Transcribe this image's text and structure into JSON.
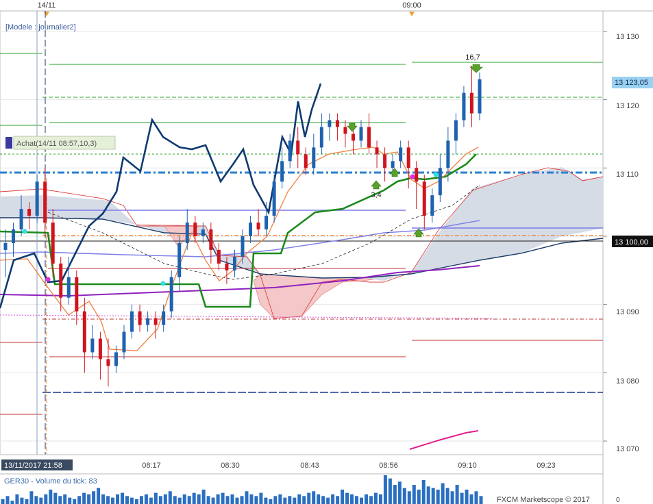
{
  "top_axis": {
    "labels": [
      "14/11",
      "09:00"
    ]
  },
  "header": {
    "model_label": "[Modele : journalier2]",
    "order_label": "Achat(14/11 08:57,10,3)"
  },
  "signals": {
    "arrow_values": [
      "16,7",
      "3,4"
    ]
  },
  "price_axis": {
    "ticks": [
      "13 130",
      "13 120",
      "13 110",
      "13 100",
      "13 090",
      "13 080",
      "13 070"
    ],
    "last_price": "13 123,05",
    "level_label": "13 100,00"
  },
  "time_axis": {
    "cursor_label": "13/11/2017 21:58",
    "ticks": [
      "08:17",
      "08:30",
      "08:43",
      "08:56",
      "09:10",
      "09:23"
    ]
  },
  "volume_panel": {
    "label": "GER30 - Volume du tick: 83",
    "brand": "FXCM Marketscope © 2017",
    "axis_zero": "0",
    "values": [
      3,
      5,
      2,
      6,
      4,
      3,
      8,
      5,
      4,
      6,
      9,
      7,
      5,
      6,
      4,
      3,
      5,
      7,
      6,
      8,
      10,
      6,
      5,
      4,
      6,
      7,
      5,
      4,
      3,
      5,
      6,
      4,
      7,
      5,
      6,
      8,
      5,
      4,
      6,
      5,
      7,
      6,
      9,
      5,
      4,
      6,
      7,
      5,
      6,
      4,
      5,
      8,
      6,
      5,
      7,
      4,
      3,
      5,
      6,
      4,
      5,
      4,
      6,
      5,
      7,
      8,
      6,
      5,
      4,
      6,
      5,
      9,
      7,
      6,
      5,
      4,
      6,
      5,
      7,
      6,
      18,
      16,
      12,
      14,
      10,
      8,
      12,
      9,
      15,
      11,
      10,
      9,
      13,
      10,
      8,
      12,
      7,
      9,
      6,
      8,
      5
    ]
  },
  "chart_data": {
    "type": "candlestick",
    "symbol": "GER30",
    "y_range": [
      13068,
      13133
    ],
    "x_ticks": [
      "08:17",
      "08:30",
      "08:43",
      "08:56",
      "09:10",
      "09:23"
    ],
    "last_price": 13123.05,
    "candles": [
      [
        13098,
        13099,
        13094,
        13101
      ],
      [
        13099,
        13101,
        13097,
        13102
      ],
      [
        13101,
        13104,
        13100,
        13106
      ],
      [
        13104,
        13103,
        13101,
        13105
      ],
      [
        13103,
        13108,
        13102,
        13109
      ],
      [
        13108,
        13102,
        13100,
        13110
      ],
      [
        13102,
        13096,
        13094,
        13104
      ],
      [
        13096,
        13091,
        13089,
        13097
      ],
      [
        13091,
        13094,
        13090,
        13097
      ],
      [
        13094,
        13089,
        13087,
        13095
      ],
      [
        13089,
        13083,
        13080,
        13091
      ],
      [
        13083,
        13085,
        13082,
        13087
      ],
      [
        13085,
        13082,
        13079,
        13086
      ],
      [
        13082,
        13081,
        13078,
        13085
      ],
      [
        13081,
        13083,
        13080,
        13084
      ],
      [
        13083,
        13086,
        13082,
        13087
      ],
      [
        13086,
        13089,
        13085,
        13090
      ],
      [
        13089,
        13087,
        13086,
        13090
      ],
      [
        13087,
        13088,
        13086,
        13089
      ],
      [
        13088,
        13087,
        13085,
        13089
      ],
      [
        13087,
        13089,
        13086,
        13090
      ],
      [
        13089,
        13094,
        13088,
        13095
      ],
      [
        13094,
        13099,
        13092,
        13100
      ],
      [
        13099,
        13102,
        13098,
        13104
      ],
      [
        13102,
        13100,
        13099,
        13103
      ],
      [
        13100,
        13101,
        13099,
        13102
      ],
      [
        13101,
        13098,
        13096,
        13102
      ],
      [
        13098,
        13096,
        13095,
        13099
      ],
      [
        13096,
        13095,
        13093,
        13097
      ],
      [
        13095,
        13097,
        13094,
        13098
      ],
      [
        13097,
        13100,
        13096,
        13101
      ],
      [
        13100,
        13102,
        13099,
        13103
      ],
      [
        13102,
        13101,
        13100,
        13104
      ],
      [
        13101,
        13103,
        13100,
        13105
      ],
      [
        13103,
        13108,
        13102,
        13109
      ],
      [
        13108,
        13111,
        13107,
        13113
      ],
      [
        13111,
        13114,
        13110,
        13115
      ],
      [
        13114,
        13112,
        13110,
        13116
      ],
      [
        13112,
        13110,
        13109,
        13113
      ],
      [
        13110,
        13113,
        13109,
        13115
      ],
      [
        13113,
        13116,
        13112,
        13118
      ],
      [
        13116,
        13117,
        13114,
        13118
      ],
      [
        13117,
        13116,
        13114,
        13118
      ],
      [
        13116,
        13115,
        13113,
        13117
      ],
      [
        13115,
        13114,
        13112,
        13116
      ],
      [
        13114,
        13116,
        13113,
        13117
      ],
      [
        13116,
        13113,
        13112,
        13118
      ],
      [
        13113,
        13112,
        13110,
        13114
      ],
      [
        13112,
        13110,
        13108,
        13113
      ],
      [
        13110,
        13111,
        13109,
        13112
      ],
      [
        13111,
        13113,
        13110,
        13114
      ],
      [
        13113,
        13110,
        13107,
        13114
      ],
      [
        13110,
        13108,
        13104,
        13111
      ],
      [
        13108,
        13103,
        13101,
        13109
      ],
      [
        13103,
        13106,
        13102,
        13107
      ],
      [
        13106,
        13110,
        13105,
        13112
      ],
      [
        13110,
        13114,
        13108,
        13116
      ],
      [
        13114,
        13117,
        13112,
        13118
      ],
      [
        13117,
        13121,
        13116,
        13122
      ],
      [
        13121,
        13118,
        13116,
        13125
      ],
      [
        13118,
        13123,
        13117,
        13124
      ]
    ]
  }
}
